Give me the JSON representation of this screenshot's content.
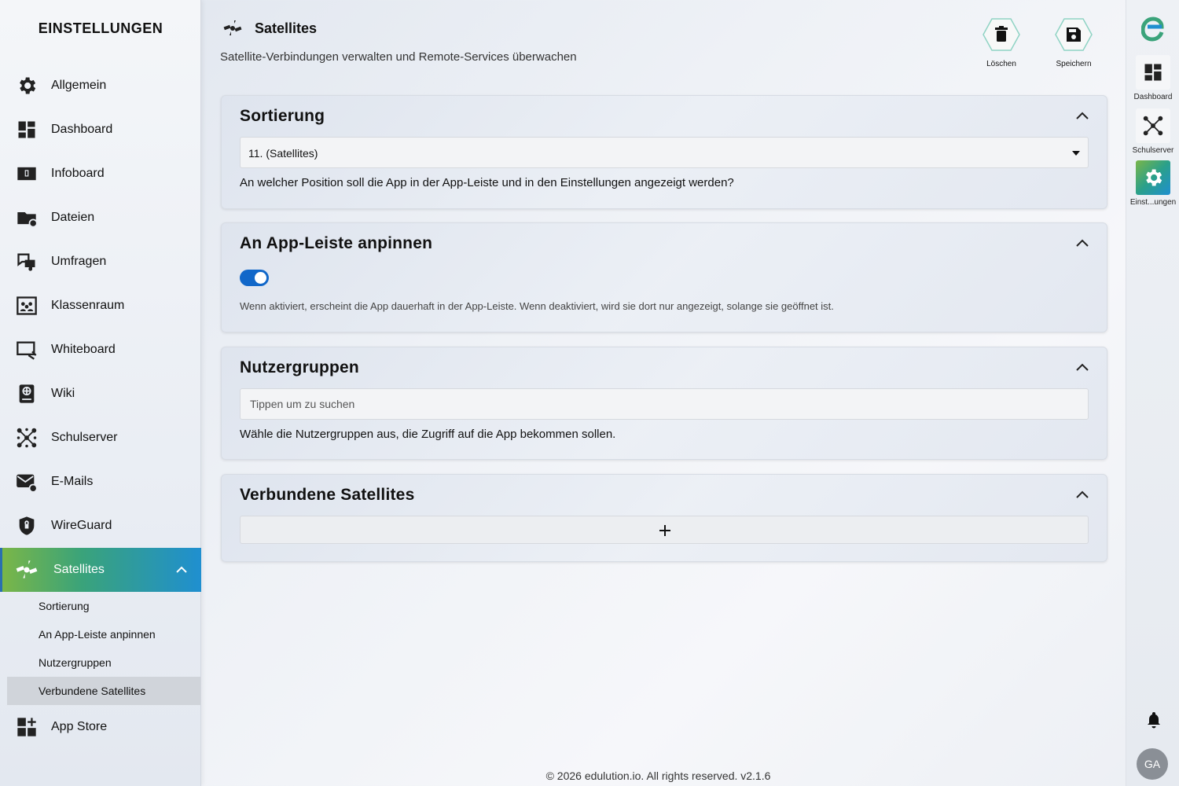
{
  "sidebar": {
    "title": "EINSTELLUNGEN",
    "items": [
      {
        "label": "Allgemein",
        "icon": "gear-icon"
      },
      {
        "label": "Dashboard",
        "icon": "dashboard-icon"
      },
      {
        "label": "Infoboard",
        "icon": "infoboard-icon"
      },
      {
        "label": "Dateien",
        "icon": "folder-icon"
      },
      {
        "label": "Umfragen",
        "icon": "survey-icon"
      },
      {
        "label": "Klassenraum",
        "icon": "classroom-icon"
      },
      {
        "label": "Whiteboard",
        "icon": "whiteboard-icon"
      },
      {
        "label": "Wiki",
        "icon": "book-icon"
      },
      {
        "label": "Schulserver",
        "icon": "network-icon"
      },
      {
        "label": "E-Mails",
        "icon": "mail-icon"
      },
      {
        "label": "WireGuard",
        "icon": "shield-icon"
      },
      {
        "label": "Satellites",
        "icon": "satellite-icon"
      }
    ],
    "sub_items": [
      {
        "label": "Sortierung"
      },
      {
        "label": "An App-Leiste anpinnen"
      },
      {
        "label": "Nutzergruppen"
      },
      {
        "label": "Verbundene Satellites"
      }
    ],
    "app_store": {
      "label": "App Store",
      "icon": "app-store-icon"
    }
  },
  "header": {
    "title": "Satellites",
    "subtitle": "Satellite-Verbindungen verwalten und Remote-Services überwachen",
    "delete_label": "Löschen",
    "save_label": "Speichern"
  },
  "cards": {
    "sort": {
      "title": "Sortierung",
      "selected": "11. (Satellites)",
      "help": "An welcher Position soll die App in der App-Leiste und in den Einstellungen angezeigt werden?"
    },
    "pin": {
      "title": "An App-Leiste anpinnen",
      "enabled": true,
      "help": "Wenn aktiviert, erscheint die App dauerhaft in der App-Leiste. Wenn deaktiviert, wird sie dort nur angezeigt, solange sie geöffnet ist."
    },
    "groups": {
      "title": "Nutzergruppen",
      "placeholder": "Tippen um zu suchen",
      "help": "Wähle die Nutzergruppen aus, die Zugriff auf die App bekommen sollen."
    },
    "connected": {
      "title": "Verbundene Satellites"
    }
  },
  "footer": {
    "text": "© 2026 edulution.io. All rights reserved. v2.1.6"
  },
  "rail": {
    "items": [
      {
        "label": "Dashboard",
        "icon": "dashboard-icon"
      },
      {
        "label": "Schulserver",
        "icon": "network-icon"
      },
      {
        "label": "Einst...ungen",
        "icon": "gear-icon"
      }
    ],
    "avatar": "GA"
  },
  "colors": {
    "accent_blue": "#1167c9",
    "gradient_green": "#7ab648",
    "gradient_blue": "#1f8fd0"
  }
}
